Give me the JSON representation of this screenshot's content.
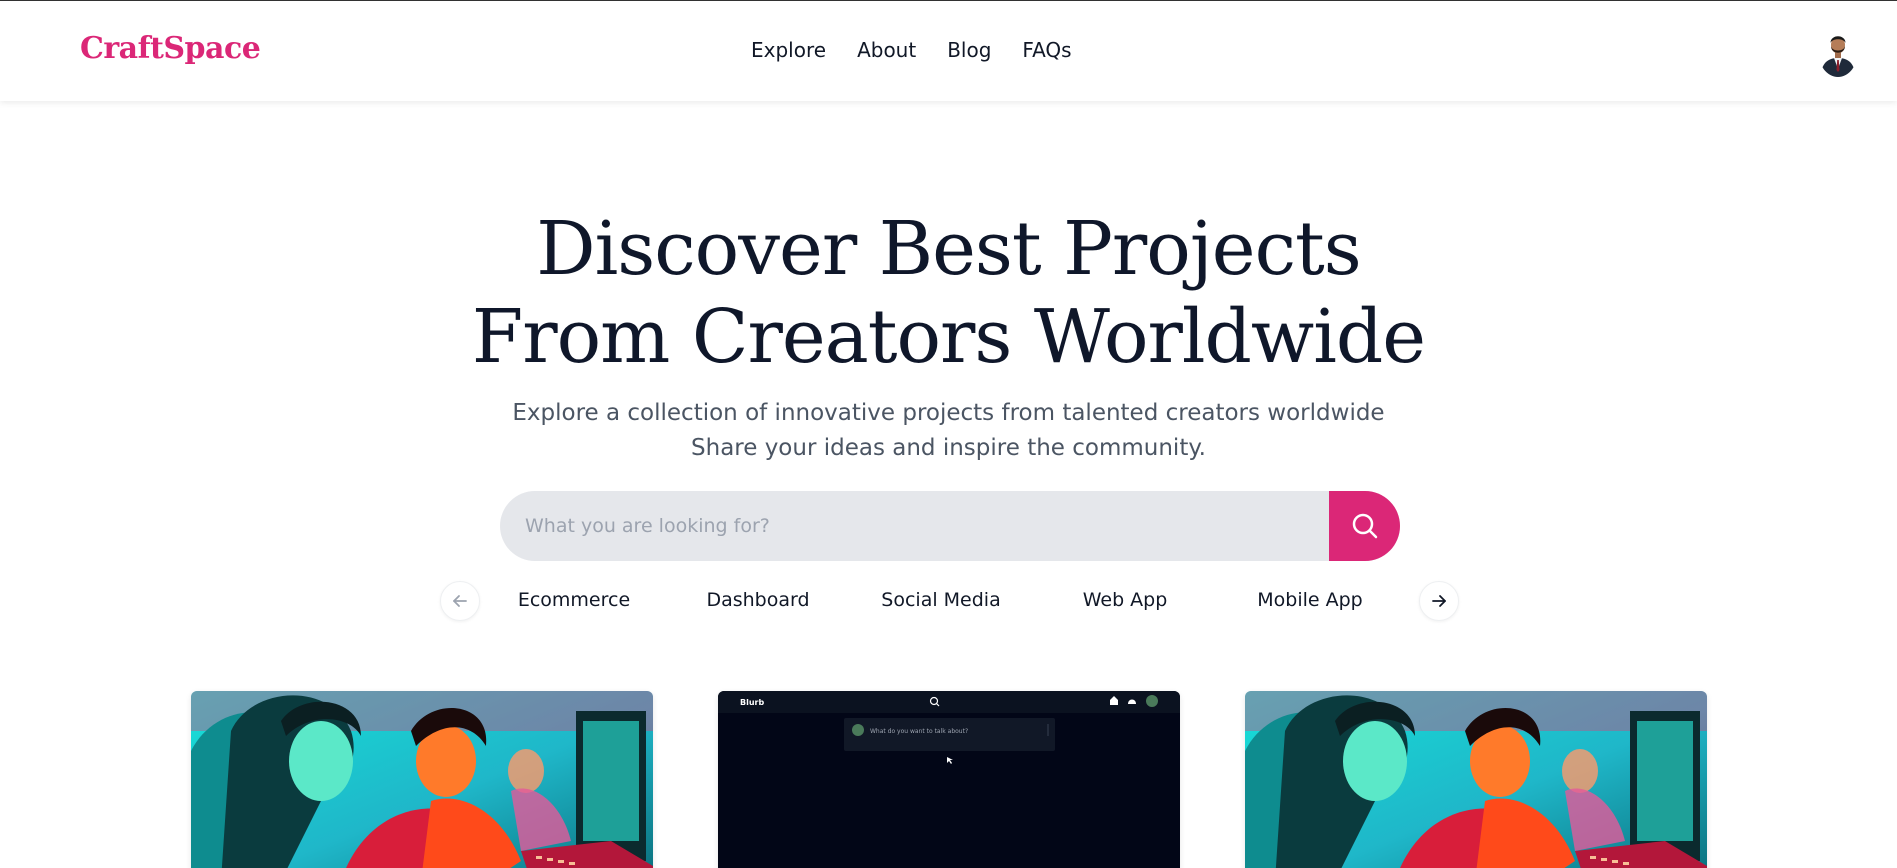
{
  "brand": {
    "name": "CraftSpace",
    "color": "#db2777"
  },
  "nav": {
    "links": [
      {
        "label": "Explore"
      },
      {
        "label": "About"
      },
      {
        "label": "Blog"
      },
      {
        "label": "FAQs"
      }
    ],
    "avatar_icon": "user-avatar"
  },
  "hero": {
    "title_line1": "Discover Best Projects",
    "title_line2": "From Creators Worldwide",
    "subtitle_line1": "Explore a collection of innovative projects from talented creators worldwide",
    "subtitle_line2": "Share your ideas and inspire the community."
  },
  "search": {
    "placeholder": "What you are looking for?",
    "value": "",
    "button_icon": "search-icon"
  },
  "categories": {
    "prev_icon": "arrow-left-icon",
    "next_icon": "arrow-right-icon",
    "items": [
      {
        "label": "Ecommerce"
      },
      {
        "label": "Dashboard"
      },
      {
        "label": "Social Media"
      },
      {
        "label": "Web App"
      },
      {
        "label": "Mobile App"
      }
    ]
  },
  "projects": {
    "cards": [
      {
        "thumbnail": "creators-gaming-artwork"
      },
      {
        "thumbnail": "blurb-app-screenshot",
        "screenshot_app_name": "Blurb",
        "screenshot_prompt": "What do you want to talk about?"
      },
      {
        "thumbnail": "creators-gaming-artwork"
      }
    ]
  }
}
